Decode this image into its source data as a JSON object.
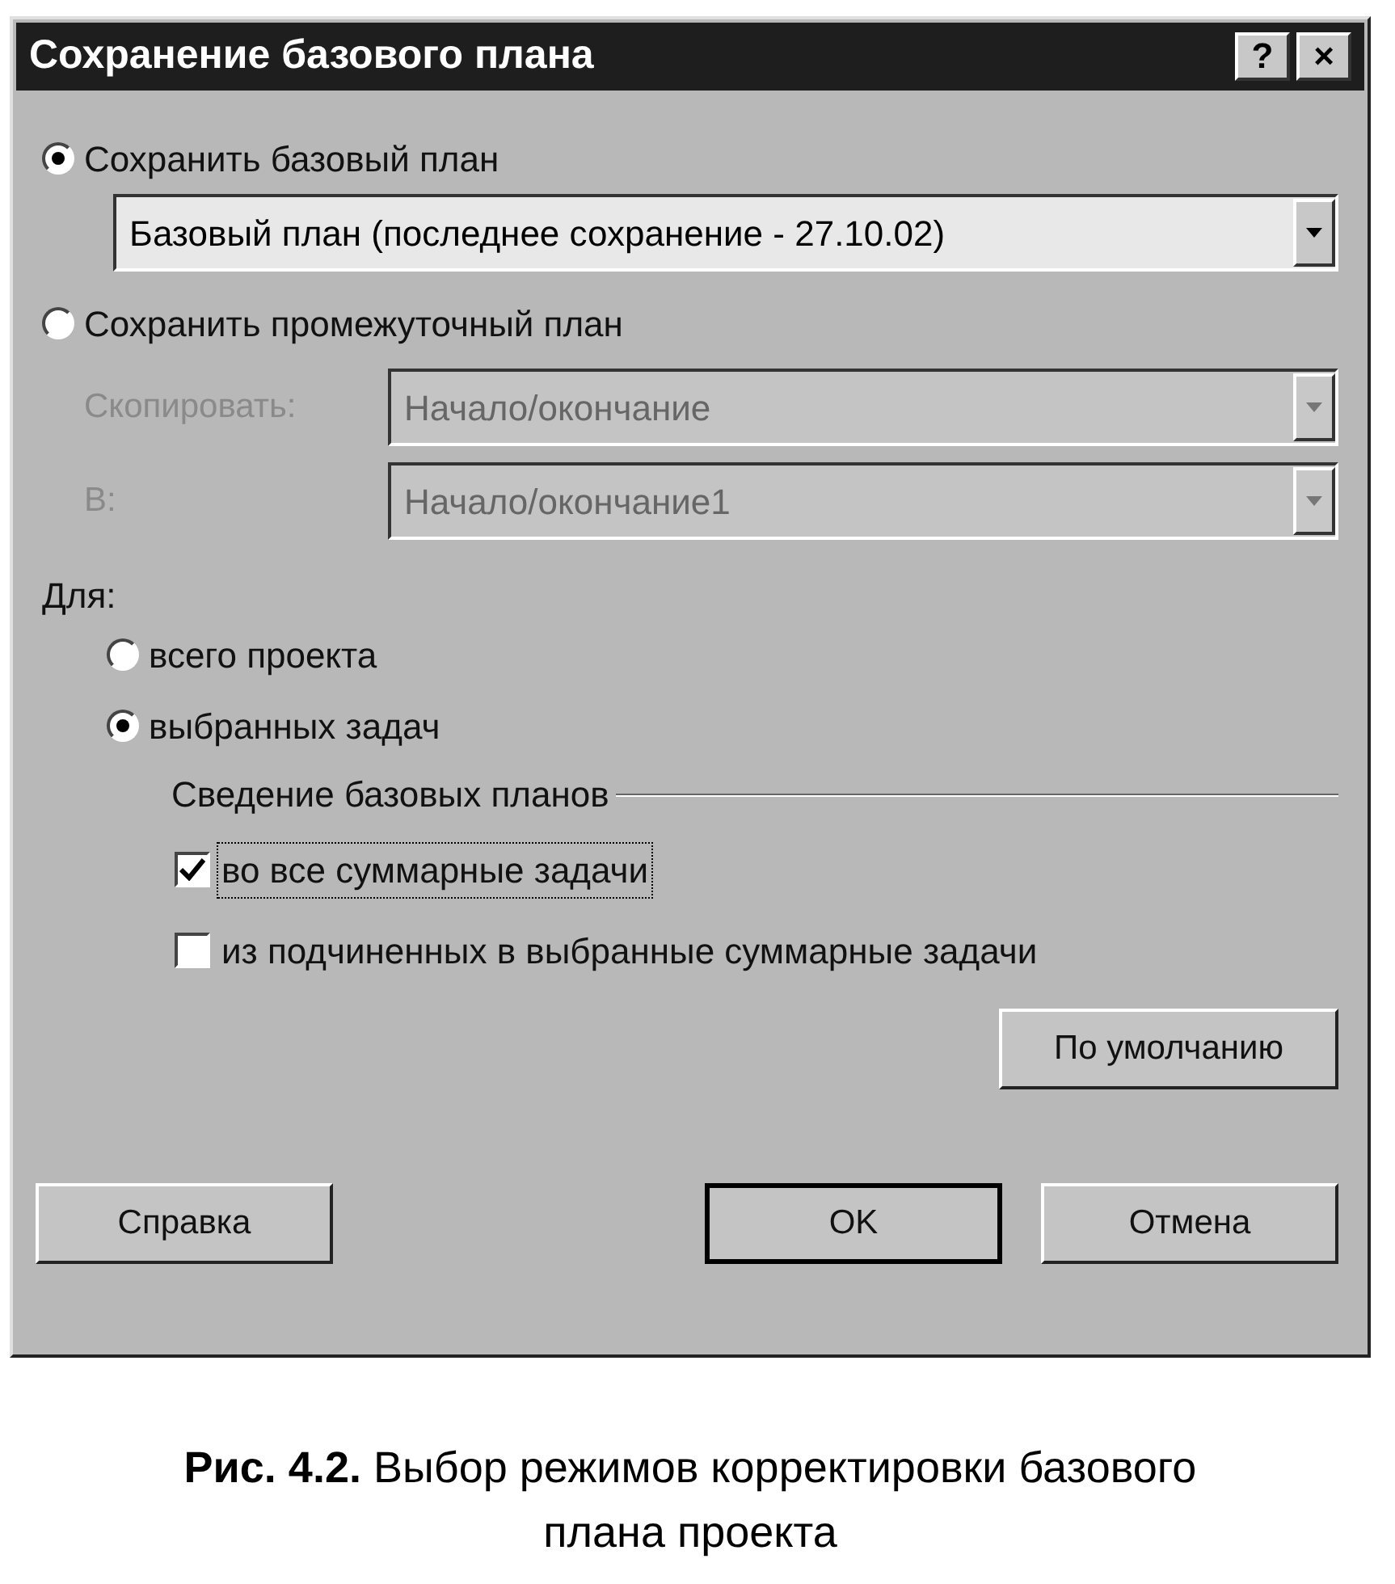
{
  "window": {
    "title": "Сохранение базового плана",
    "title_buttons": [
      "?",
      "×"
    ]
  },
  "save_options": [
    {
      "label": "Сохранить базовый план",
      "selected": true
    },
    {
      "label": "Сохранить промежуточный план",
      "selected": false
    }
  ],
  "baseline_combo": {
    "value": "Базовый план (последнее сохранение - 27.10.02)"
  },
  "interim": {
    "disabled": true,
    "fields": [
      {
        "label": "Скопировать:",
        "value": "Начало/окончание"
      },
      {
        "label": "В:",
        "value": "Начало/окончание1"
      }
    ]
  },
  "for": {
    "label": "Для:",
    "options": [
      {
        "label": "всего проекта",
        "selected": false
      },
      {
        "label": "выбранных задач",
        "selected": true
      }
    ]
  },
  "rollup": {
    "title": "Сведение базовых планов",
    "checkboxes": [
      {
        "label": "во все суммарные задачи",
        "checked": true,
        "focused": true
      },
      {
        "label": "из подчиненных в выбранные суммарные задачи",
        "checked": false,
        "focused": false
      }
    ]
  },
  "default_button": "По умолчанию",
  "buttons": [
    {
      "label": "Справка",
      "default": false
    },
    {
      "label": "OK",
      "default": true
    },
    {
      "label": "Отмена",
      "default": false
    }
  ],
  "caption": {
    "number": "Рис. 4.2.",
    "text": "Выбор режимов корректировки базового плана проекта"
  }
}
